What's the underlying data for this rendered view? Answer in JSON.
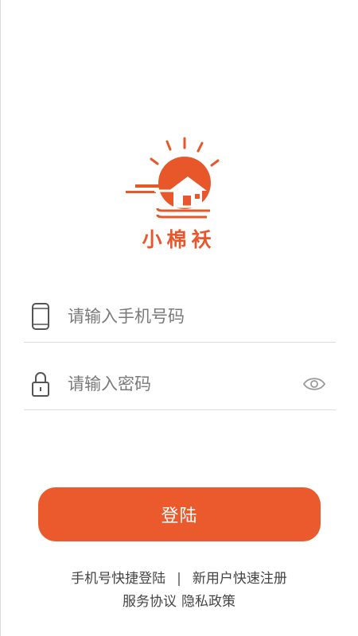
{
  "brand": {
    "name": "小棉袄",
    "color": "#e8572a",
    "logo_icon": "sun-house-logo"
  },
  "login_form": {
    "phone": {
      "placeholder": "请输入手机号码",
      "value": "",
      "icon": "phone-icon"
    },
    "password": {
      "placeholder": "请输入密码",
      "value": "",
      "icon": "lock-icon",
      "visibility_icon": "eye-icon"
    },
    "submit_label": "登陆",
    "submit_color": "#ea5a2c"
  },
  "links": {
    "quick_login": "手机号快捷登陆",
    "separator": "|",
    "register": "新用户快速注册",
    "terms": "服务协议",
    "privacy": "隐私政策"
  }
}
